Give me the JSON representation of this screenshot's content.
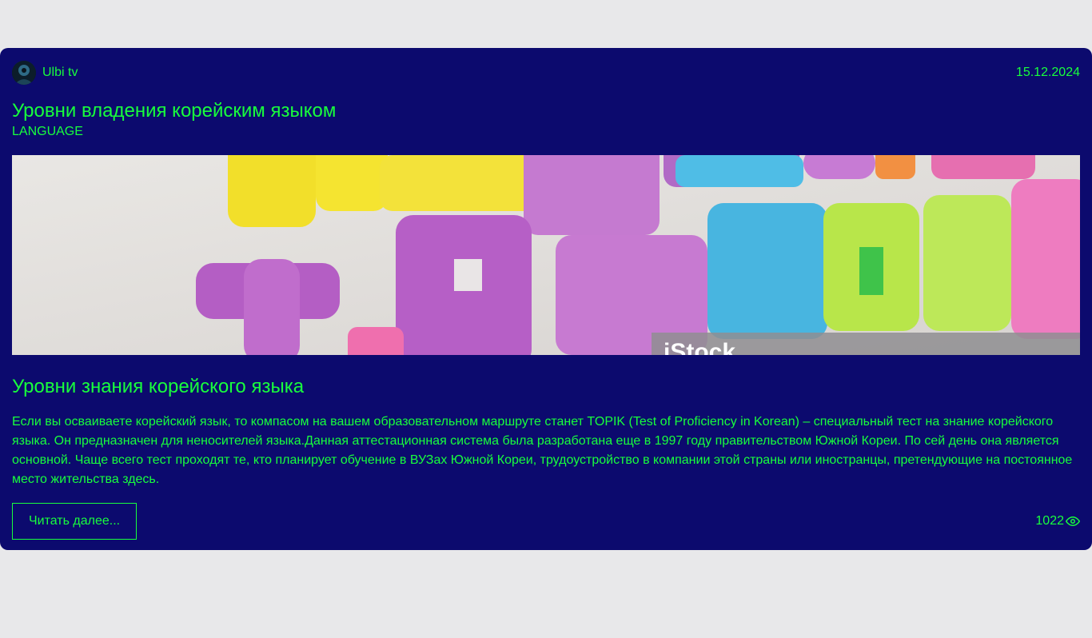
{
  "card": {
    "author": "Ulbi tv",
    "date": "15.12.2024",
    "title": "Уровни владения корейским языком",
    "tag": "LANGUAGE",
    "image_watermark": "iStock",
    "subtitle": "Уровни знания корейского языка",
    "text": "Если вы осваиваете корейский язык, то компасом на вашем образовательном маршруте станет TOPIK (Test of Proficiency in Korean) – специальный тест на знание корейского языка. Он предназначен для неносителей языка.Данная аттестационная система была разработана еще в 1997 году правительством Южной Кореи. По сей день она является основной. Чаще всего тест проходят те, кто планирует обучение в ВУЗах Южной Кореи, трудоустройство в компании этой страны или иностранцы, претендующие на постоянное место жительства здесь.",
    "read_more_label": "Читать далее...",
    "views": "1022",
    "icons": {
      "avatar": "avatar-image",
      "views": "eye-icon"
    }
  },
  "colors": {
    "page_bg": "#e8e8ea",
    "card_bg": "#0c0a6e",
    "accent": "#18ff3c"
  }
}
